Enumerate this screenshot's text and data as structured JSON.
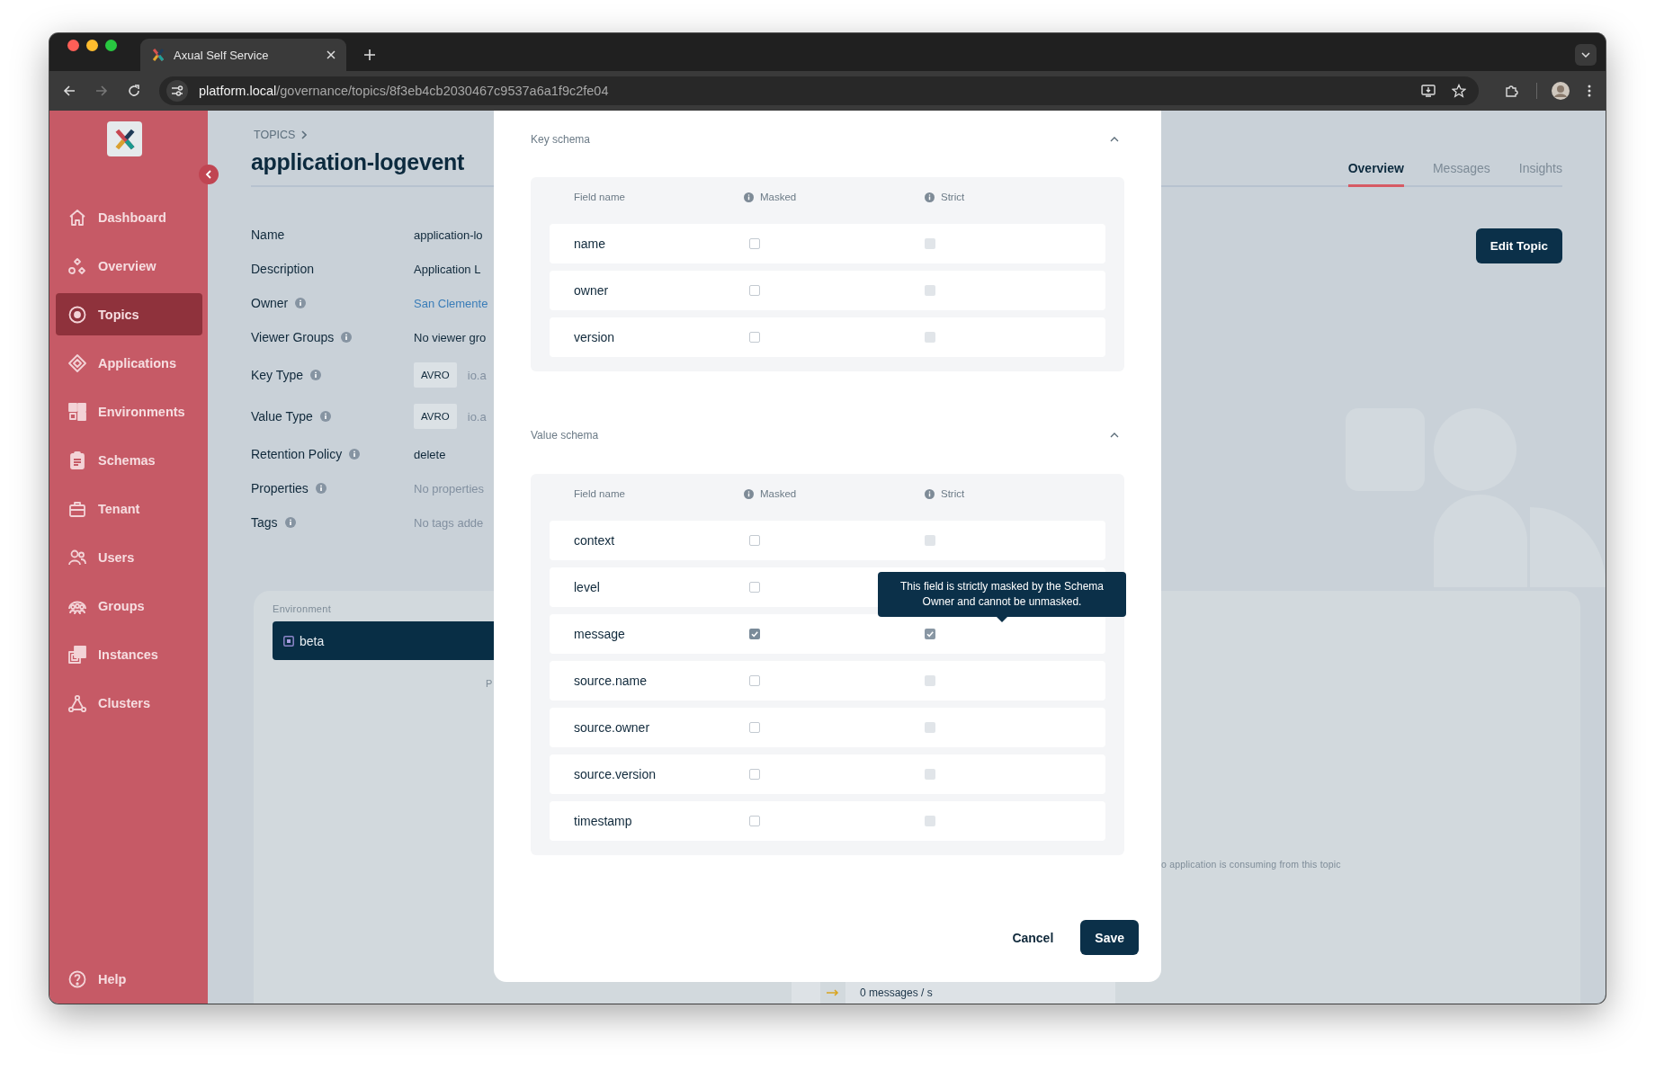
{
  "browser": {
    "tab_title": "Axual Self Service",
    "url_host": "platform.local",
    "url_path": "/governance/topics/8f3eb4cb2030467c9537a6a1f9c2fe04"
  },
  "sidebar": {
    "items": [
      {
        "label": "Dashboard",
        "selected": false
      },
      {
        "label": "Overview",
        "selected": false
      },
      {
        "label": "Topics",
        "selected": true
      },
      {
        "label": "Applications",
        "selected": false
      },
      {
        "label": "Environments",
        "selected": false
      },
      {
        "label": "Schemas",
        "selected": false
      },
      {
        "label": "Tenant",
        "selected": false
      },
      {
        "label": "Users",
        "selected": false
      },
      {
        "label": "Groups",
        "selected": false
      },
      {
        "label": "Instances",
        "selected": false
      },
      {
        "label": "Clusters",
        "selected": false
      }
    ],
    "help": "Help"
  },
  "breadcrumb": "TOPICS",
  "title": "application-logevent",
  "tabs": [
    {
      "label": "Overview",
      "selected": true
    },
    {
      "label": "Messages",
      "selected": false
    },
    {
      "label": "Insights",
      "selected": false
    }
  ],
  "edit_button": "Edit Topic",
  "properties": [
    {
      "label": "Name",
      "info": false,
      "kind": "text",
      "value": "application-lo"
    },
    {
      "label": "Description",
      "info": false,
      "kind": "text",
      "value": "Application L"
    },
    {
      "label": "Owner",
      "info": true,
      "kind": "link",
      "value": "San Clemente"
    },
    {
      "label": "Viewer Groups",
      "info": true,
      "kind": "text",
      "value": "No viewer gro"
    },
    {
      "label": "Key Type",
      "info": true,
      "kind": "badge",
      "badge": "AVRO",
      "value": "io.a"
    },
    {
      "label": "Value Type",
      "info": true,
      "kind": "badge",
      "badge": "AVRO",
      "value": "io.a"
    },
    {
      "label": "Retention Policy",
      "info": true,
      "kind": "text",
      "value": "delete"
    },
    {
      "label": "Properties",
      "info": true,
      "kind": "muted",
      "value": "No properties"
    },
    {
      "label": "Tags",
      "info": true,
      "kind": "muted",
      "value": "No tags adde"
    }
  ],
  "environment": {
    "label": "Environment",
    "selected_env": "beta",
    "cut_label": "P"
  },
  "consumers_note": "o application is consuming from this topic",
  "throughput": "0 messages / s",
  "modal": {
    "sections": [
      {
        "title": "Key schema",
        "expanded": true,
        "columns": [
          "Field name",
          "Masked",
          "Strict"
        ],
        "rows": [
          {
            "field": "name",
            "masked": false,
            "strict": false
          },
          {
            "field": "owner",
            "masked": false,
            "strict": false
          },
          {
            "field": "version",
            "masked": false,
            "strict": false
          }
        ]
      },
      {
        "title": "Value schema",
        "expanded": true,
        "columns": [
          "Field name",
          "Masked",
          "Strict"
        ],
        "rows": [
          {
            "field": "context",
            "masked": false,
            "strict": false
          },
          {
            "field": "level",
            "masked": false
          },
          {
            "field": "message",
            "masked": true,
            "strict": true,
            "tooltip": "This field is strictly masked by the Schema Owner and cannot be unmasked."
          },
          {
            "field": "source.name",
            "masked": false,
            "strict": false
          },
          {
            "field": "source.owner",
            "masked": false,
            "strict": false
          },
          {
            "field": "source.version",
            "masked": false,
            "strict": false
          },
          {
            "field": "timestamp",
            "masked": false,
            "strict": false
          }
        ]
      }
    ],
    "buttons": [
      {
        "label": "Cancel",
        "kind": "text"
      },
      {
        "label": "Save",
        "kind": "primary"
      }
    ]
  }
}
